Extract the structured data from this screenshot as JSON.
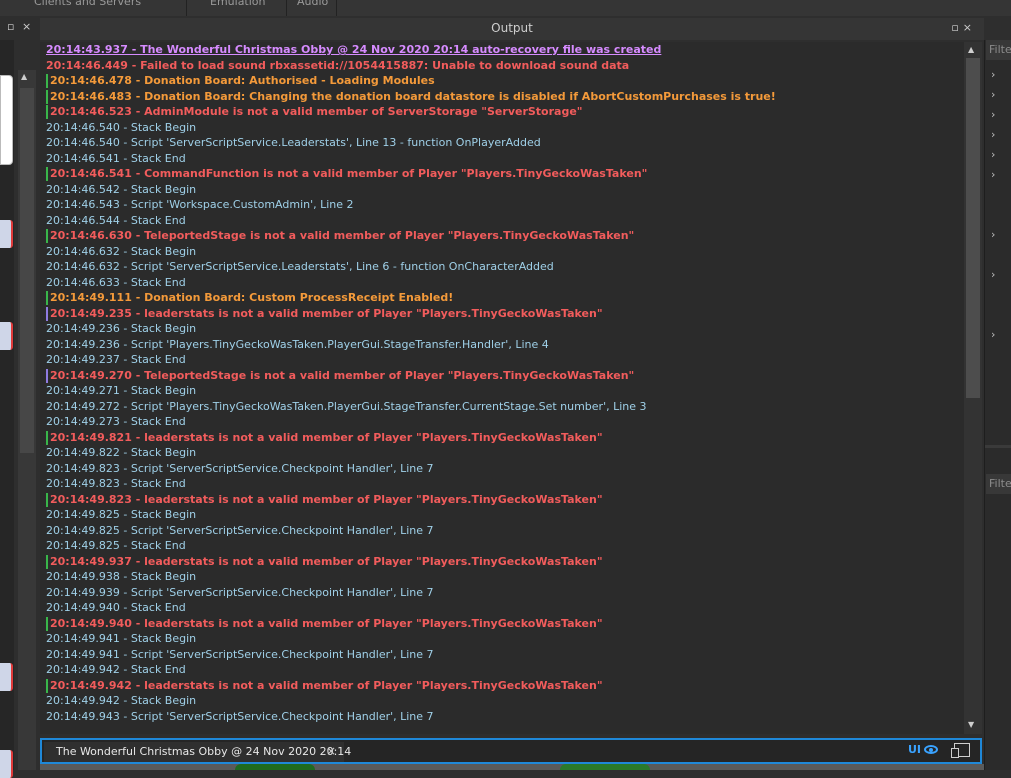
{
  "top_tabs": [
    "Clients and Servers",
    "Emulation",
    "Audio"
  ],
  "left_panel": {
    "pin_icon": "▫",
    "close_icon": "×"
  },
  "output": {
    "title": "Output",
    "pin_icon": "▫",
    "close_icon": "×",
    "lines": [
      {
        "type": "link",
        "bar": false,
        "text": "20:14:43.937 - The Wonderful Christmas Obby @ 24 Nov 2020 20:14 auto-recovery file was created"
      },
      {
        "type": "err",
        "bar": false,
        "text": "20:14:46.449 - Failed to load sound rbxassetid://1054415887: Unable to download sound data"
      },
      {
        "type": "warn",
        "bar": true,
        "text": "20:14:46.478 - Donation Board: Authorised - Loading Modules"
      },
      {
        "type": "warn",
        "bar": true,
        "text": "20:14:46.483 - Donation Board: Changing the donation board datastore is disabled if AbortCustomPurchases is true!"
      },
      {
        "type": "err",
        "bar": true,
        "text": "20:14:46.523 - AdminModule is not a valid member of ServerStorage \"ServerStorage\""
      },
      {
        "type": "info",
        "bar": false,
        "text": "20:14:46.540 - Stack Begin"
      },
      {
        "type": "info",
        "bar": false,
        "text": "20:14:46.540 - Script 'ServerScriptService.Leaderstats', Line 13 - function OnPlayerAdded"
      },
      {
        "type": "info",
        "bar": false,
        "text": "20:14:46.541 - Stack End"
      },
      {
        "type": "err",
        "bar": true,
        "text": "20:14:46.541 - CommandFunction is not a valid member of Player \"Players.TinyGeckoWasTaken\""
      },
      {
        "type": "info",
        "bar": false,
        "text": "20:14:46.542 - Stack Begin"
      },
      {
        "type": "info",
        "bar": false,
        "text": "20:14:46.543 - Script 'Workspace.CustomAdmin', Line 2"
      },
      {
        "type": "info",
        "bar": false,
        "text": "20:14:46.544 - Stack End"
      },
      {
        "type": "err",
        "bar": true,
        "text": "20:14:46.630 - TeleportedStage is not a valid member of Player \"Players.TinyGeckoWasTaken\""
      },
      {
        "type": "info",
        "bar": false,
        "text": "20:14:46.632 - Stack Begin"
      },
      {
        "type": "info",
        "bar": false,
        "text": "20:14:46.632 - Script 'ServerScriptService.Leaderstats', Line 6 - function OnCharacterAdded"
      },
      {
        "type": "info",
        "bar": false,
        "text": "20:14:46.633 - Stack End"
      },
      {
        "type": "warn",
        "bar": true,
        "text": "20:14:49.111 - Donation Board: Custom ProcessReceipt Enabled!"
      },
      {
        "type": "err",
        "bar": true,
        "purple": true,
        "text": "20:14:49.235 - leaderstats is not a valid member of Player \"Players.TinyGeckoWasTaken\""
      },
      {
        "type": "info",
        "bar": false,
        "text": "20:14:49.236 - Stack Begin"
      },
      {
        "type": "info",
        "bar": false,
        "text": "20:14:49.236 - Script 'Players.TinyGeckoWasTaken.PlayerGui.StageTransfer.Handler', Line 4"
      },
      {
        "type": "info",
        "bar": false,
        "text": "20:14:49.237 - Stack End"
      },
      {
        "type": "err",
        "bar": true,
        "purple": true,
        "text": "20:14:49.270 - TeleportedStage is not a valid member of Player \"Players.TinyGeckoWasTaken\""
      },
      {
        "type": "info",
        "bar": false,
        "text": "20:14:49.271 - Stack Begin"
      },
      {
        "type": "info",
        "bar": false,
        "text": "20:14:49.272 - Script 'Players.TinyGeckoWasTaken.PlayerGui.StageTransfer.CurrentStage.Set number', Line 3"
      },
      {
        "type": "info",
        "bar": false,
        "text": "20:14:49.273 - Stack End"
      },
      {
        "type": "err",
        "bar": true,
        "text": "20:14:49.821 - leaderstats is not a valid member of Player \"Players.TinyGeckoWasTaken\""
      },
      {
        "type": "info",
        "bar": false,
        "text": "20:14:49.822 - Stack Begin"
      },
      {
        "type": "info",
        "bar": false,
        "text": "20:14:49.823 - Script 'ServerScriptService.Checkpoint Handler', Line 7"
      },
      {
        "type": "info",
        "bar": false,
        "text": "20:14:49.823 - Stack End"
      },
      {
        "type": "err",
        "bar": true,
        "text": "20:14:49.823 - leaderstats is not a valid member of Player \"Players.TinyGeckoWasTaken\""
      },
      {
        "type": "info",
        "bar": false,
        "text": "20:14:49.825 - Stack Begin"
      },
      {
        "type": "info",
        "bar": false,
        "text": "20:14:49.825 - Script 'ServerScriptService.Checkpoint Handler', Line 7"
      },
      {
        "type": "info",
        "bar": false,
        "text": "20:14:49.825 - Stack End"
      },
      {
        "type": "err",
        "bar": true,
        "text": "20:14:49.937 - leaderstats is not a valid member of Player \"Players.TinyGeckoWasTaken\""
      },
      {
        "type": "info",
        "bar": false,
        "text": "20:14:49.938 - Stack Begin"
      },
      {
        "type": "info",
        "bar": false,
        "text": "20:14:49.939 - Script 'ServerScriptService.Checkpoint Handler', Line 7"
      },
      {
        "type": "info",
        "bar": false,
        "text": "20:14:49.940 - Stack End"
      },
      {
        "type": "err",
        "bar": true,
        "text": "20:14:49.940 - leaderstats is not a valid member of Player \"Players.TinyGeckoWasTaken\""
      },
      {
        "type": "info",
        "bar": false,
        "text": "20:14:49.941 - Stack Begin"
      },
      {
        "type": "info",
        "bar": false,
        "text": "20:14:49.941 - Script 'ServerScriptService.Checkpoint Handler', Line 7"
      },
      {
        "type": "info",
        "bar": false,
        "text": "20:14:49.942 - Stack End"
      },
      {
        "type": "err",
        "bar": true,
        "text": "20:14:49.942 - leaderstats is not a valid member of Player \"Players.TinyGeckoWasTaken\""
      },
      {
        "type": "info",
        "bar": false,
        "text": "20:14:49.942 - Stack Begin"
      },
      {
        "type": "info",
        "bar": false,
        "text": "20:14:49.943 - Script 'ServerScriptService.Checkpoint Handler', Line 7"
      }
    ]
  },
  "right_panel": {
    "filter_top": "Filte",
    "filter_bottom": "Filte",
    "chevron_icon": "›"
  },
  "bottom_tab": {
    "label": "The Wonderful Christmas Obby @ 24 Nov 2020 20:14",
    "close_icon": "×",
    "ui_label": "UI"
  },
  "colors": {
    "error": "#f25c5c",
    "warning": "#f49a3a",
    "info": "#9fd0e8",
    "link": "#d68bff",
    "accent": "#1f88d8"
  }
}
